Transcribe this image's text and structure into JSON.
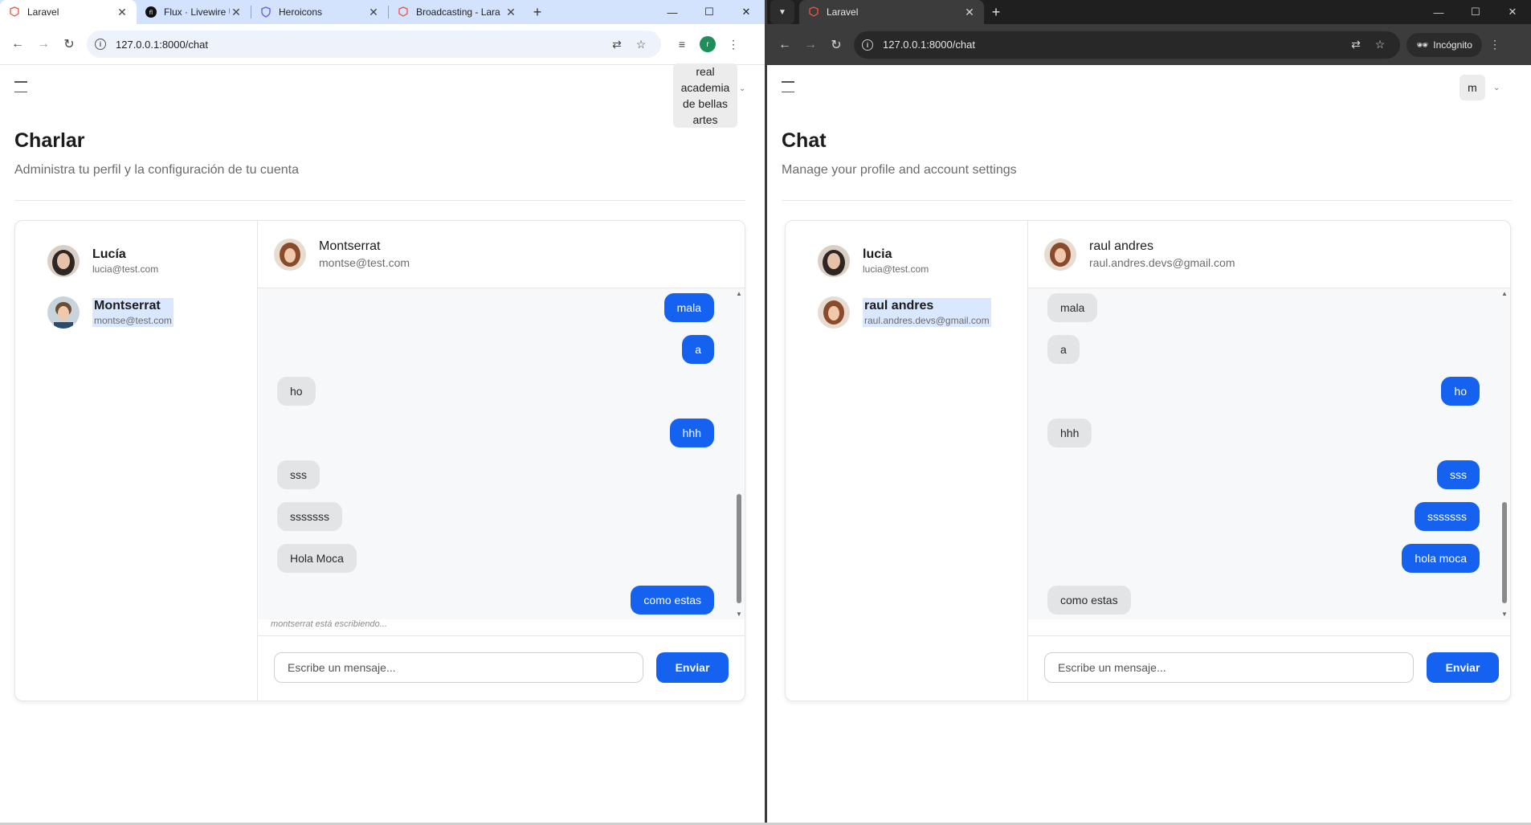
{
  "left_window": {
    "tabs": [
      {
        "title": "Laravel",
        "favicon": "laravel-icon",
        "active": true
      },
      {
        "title": "Flux · Livewire UI kit",
        "favicon": "flux-icon",
        "active": false
      },
      {
        "title": "Heroicons",
        "favicon": "heroicons-shield-icon",
        "active": false
      },
      {
        "title": "Broadcasting - Lara",
        "favicon": "laravel-icon",
        "active": false
      }
    ],
    "url": "127.0.0.1:8000/chat",
    "profile_initial": "r",
    "user_name_lines": [
      "real",
      "academia",
      "de bellas",
      "artes"
    ],
    "page_title": "Charlar",
    "page_subtitle": "Administra tu perfil y la configuración de tu cuenta",
    "contacts": [
      {
        "name": "Lucía",
        "email": "lucia@test.com",
        "selected": false
      },
      {
        "name": "Montserrat",
        "email": "montse@test.com",
        "selected": true
      }
    ],
    "conversation": {
      "name": "Montserrat",
      "email": "montse@test.com",
      "messages": [
        {
          "text": "mala",
          "direction": "out"
        },
        {
          "text": "a",
          "direction": "out"
        },
        {
          "text": "ho",
          "direction": "in"
        },
        {
          "text": "hhh",
          "direction": "out"
        },
        {
          "text": "sss",
          "direction": "in"
        },
        {
          "text": "sssssss",
          "direction": "in"
        },
        {
          "text": "Hola Moca",
          "direction": "in"
        },
        {
          "text": "como estas",
          "direction": "out"
        }
      ],
      "typing_indicator": "montserrat está escribiendo...",
      "input_placeholder": "Escribe un mensaje...",
      "send_label": "Enviar"
    }
  },
  "right_window": {
    "tabs": [
      {
        "title": "Laravel",
        "favicon": "laravel-icon",
        "active": true
      }
    ],
    "url": "127.0.0.1:8000/chat",
    "incognito_label": "Incógnito",
    "user_initial": "m",
    "page_title": "Chat",
    "page_subtitle": "Manage your profile and account settings",
    "contacts": [
      {
        "name": "lucia",
        "email": "lucia@test.com",
        "selected": false
      },
      {
        "name": "raul andres",
        "email": "raul.andres.devs@gmail.com",
        "selected": true
      }
    ],
    "conversation": {
      "name": "raul andres",
      "email": "raul.andres.devs@gmail.com",
      "messages": [
        {
          "text": "mala",
          "direction": "in"
        },
        {
          "text": "a",
          "direction": "in"
        },
        {
          "text": "ho",
          "direction": "out"
        },
        {
          "text": "hhh",
          "direction": "in"
        },
        {
          "text": "sss",
          "direction": "out"
        },
        {
          "text": "sssssss",
          "direction": "out"
        },
        {
          "text": "hola moca",
          "direction": "out"
        },
        {
          "text": "como estas",
          "direction": "in"
        }
      ],
      "input_placeholder": "Escribe un mensaje...",
      "send_label": "Enviar"
    }
  },
  "colors": {
    "accent_blue": "#1662f0",
    "incoming_bubble": "#e3e4e6",
    "selected_contact_highlight": "#d9e8ff"
  }
}
